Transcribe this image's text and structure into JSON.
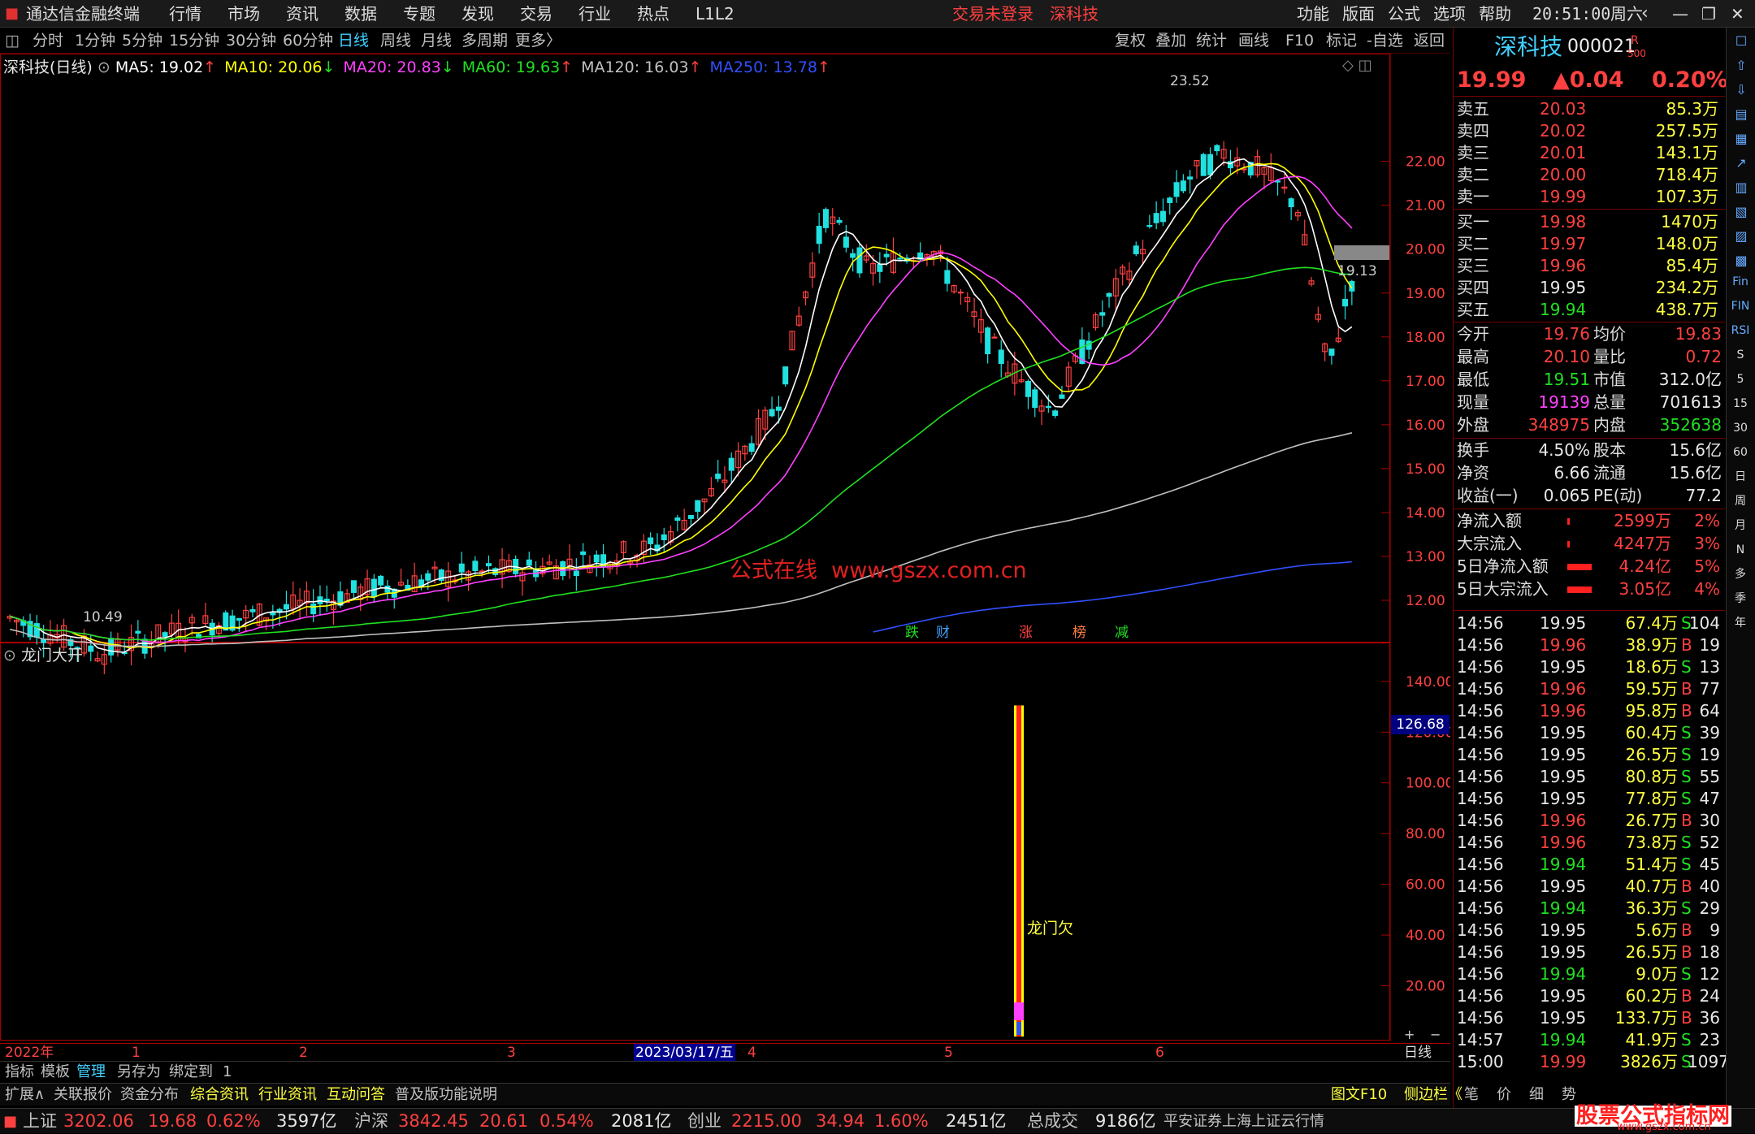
{
  "titlebar": {
    "app_title": "通达信金融终端",
    "menu": [
      "行情",
      "市场",
      "资讯",
      "数据",
      "专题",
      "发现",
      "交易",
      "行业",
      "热点",
      "L1L2"
    ],
    "login_status": "交易未登录",
    "stock_name": "深科技",
    "right_menu": [
      "功能",
      "版面",
      "公式",
      "选项",
      "帮助"
    ],
    "clock": "20:51:00",
    "weekday": "周六"
  },
  "periodbar": {
    "periods": [
      "分时",
      "1分钟",
      "5分钟",
      "15分钟",
      "30分钟",
      "60分钟",
      "日线",
      "周线",
      "月线",
      "多周期",
      "更多〉"
    ],
    "active": "日线",
    "tools": [
      "复权",
      "叠加",
      "统计",
      "画线",
      "F10",
      "标记",
      "-自选",
      "返回"
    ]
  },
  "kline": {
    "title": "深科技(日线)",
    "ma": [
      {
        "label": "MA5: 19.02",
        "arrow": "↑",
        "color": "#ffffff"
      },
      {
        "label": "MA10: 20.06",
        "arrow": "↓",
        "color": "#ffff00"
      },
      {
        "label": "MA20: 20.83",
        "arrow": "↓",
        "color": "#ff40ff"
      },
      {
        "label": "MA60: 19.63",
        "arrow": "↑",
        "color": "#20e020"
      },
      {
        "label": "MA120: 16.03",
        "arrow": "↑",
        "color": "#c0c0c0"
      },
      {
        "label": "MA250: 13.78",
        "arrow": "↑",
        "color": "#3050ff"
      }
    ],
    "high_label": "23.52",
    "low_label": "10.49",
    "cursor_label": "19.13",
    "price_axis": [
      "22.00",
      "21.00",
      "20.00",
      "19.00",
      "18.00",
      "17.00",
      "16.00",
      "15.00",
      "14.00",
      "13.00",
      "12.00"
    ],
    "watermark": "公式在线  www.gszx.com.cn",
    "event_tags": [
      {
        "t": "跌",
        "c": "#20e020"
      },
      {
        "t": "财",
        "c": "#40a0ff"
      },
      {
        "t": "涨",
        "c": "#ff4040"
      },
      {
        "t": "榜",
        "c": "#ff8040"
      },
      {
        "t": "减",
        "c": "#20e020"
      }
    ]
  },
  "indicator": {
    "title": "龙门大开",
    "axis": [
      "140.00",
      "120.00",
      "100.00",
      "80.00",
      "60.00",
      "40.00",
      "20.00"
    ],
    "current_value": "126.68",
    "bar_label": "龙门欠",
    "bar_value": 126.68
  },
  "timeaxis": {
    "labels": [
      "2022年",
      "1",
      "2",
      "3",
      "2023/03/17/五",
      "4",
      "5",
      "6"
    ],
    "period": "日线"
  },
  "bottomtabs": {
    "row1": [
      "指标",
      "模板",
      "管理",
      "另存为",
      "绑定到",
      "1"
    ],
    "row2": [
      "扩展∧",
      "关联报价",
      "资金分布",
      "综合资讯",
      "行业资讯",
      "互动问答",
      "普及版功能说明"
    ],
    "row2_right": [
      "图文F10",
      "侧边栏《",
      "笔",
      "价",
      "细",
      "势"
    ]
  },
  "quote": {
    "name": "深科技",
    "code": "000021",
    "flag_r": "R",
    "flag_500": "500",
    "price": "19.99",
    "change": "▲0.04",
    "pct": "0.20%",
    "sells": [
      {
        "l": "卖五",
        "p": "20.03",
        "v": "85.3万"
      },
      {
        "l": "卖四",
        "p": "20.02",
        "v": "257.5万"
      },
      {
        "l": "卖三",
        "p": "20.01",
        "v": "143.1万"
      },
      {
        "l": "卖二",
        "p": "20.00",
        "v": "718.4万"
      },
      {
        "l": "卖一",
        "p": "19.99",
        "v": "107.3万"
      }
    ],
    "buys": [
      {
        "l": "买一",
        "p": "19.98",
        "v": "1470万"
      },
      {
        "l": "买二",
        "p": "19.97",
        "v": "148.0万"
      },
      {
        "l": "买三",
        "p": "19.96",
        "v": "85.4万"
      },
      {
        "l": "买四",
        "p": "19.95",
        "v": "234.2万"
      },
      {
        "l": "买五",
        "p": "19.94",
        "v": "438.7万"
      }
    ],
    "stats": [
      {
        "a": "今开",
        "b": "19.76",
        "c": "均价",
        "d": "19.83"
      },
      {
        "a": "最高",
        "b": "20.10",
        "c": "量比",
        "d": "0.72"
      },
      {
        "a": "最低",
        "b": "19.51",
        "c": "市值",
        "d": "312.0亿"
      },
      {
        "a": "现量",
        "b": "19139",
        "c": "总量",
        "d": "701613"
      },
      {
        "a": "外盘",
        "b": "348975",
        "c": "内盘",
        "d": "352638"
      }
    ],
    "stats2": [
      {
        "a": "换手",
        "b": "4.50%",
        "c": "股本",
        "d": "15.6亿"
      },
      {
        "a": "净资",
        "b": "6.66",
        "c": "流通",
        "d": "15.6亿"
      },
      {
        "a": "收益(一)",
        "b": "0.065",
        "c": "PE(动)",
        "d": "77.2"
      }
    ],
    "flows": [
      {
        "a": "净流入额",
        "b": "2599万",
        "c": "2%"
      },
      {
        "a": "大宗流入",
        "b": "4247万",
        "c": "3%"
      },
      {
        "a": "5日净流入额",
        "b": "4.24亿",
        "c": "5%"
      },
      {
        "a": "5日大宗流入",
        "b": "3.05亿",
        "c": "4%"
      }
    ],
    "ticks": [
      [
        "14:56",
        "19.95",
        "67.4万",
        "S",
        "104"
      ],
      [
        "14:56",
        "19.96",
        "38.9万",
        "B",
        "19"
      ],
      [
        "14:56",
        "19.95",
        "18.6万",
        "S",
        "13"
      ],
      [
        "14:56",
        "19.96",
        "59.5万",
        "B",
        "77"
      ],
      [
        "14:56",
        "19.96",
        "95.8万",
        "B",
        "64"
      ],
      [
        "14:56",
        "19.95",
        "60.4万",
        "S",
        "39"
      ],
      [
        "14:56",
        "19.95",
        "26.5万",
        "S",
        "19"
      ],
      [
        "14:56",
        "19.95",
        "80.8万",
        "S",
        "55"
      ],
      [
        "14:56",
        "19.95",
        "77.8万",
        "S",
        "47"
      ],
      [
        "14:56",
        "19.96",
        "26.7万",
        "B",
        "30"
      ],
      [
        "14:56",
        "19.96",
        "73.8万",
        "S",
        "52"
      ],
      [
        "14:56",
        "19.94",
        "51.4万",
        "S",
        "45"
      ],
      [
        "14:56",
        "19.95",
        "40.7万",
        "B",
        "40"
      ],
      [
        "14:56",
        "19.94",
        "36.3万",
        "S",
        "29"
      ],
      [
        "14:56",
        "19.95",
        "5.6万",
        "B",
        "9"
      ],
      [
        "14:56",
        "19.95",
        "26.5万",
        "B",
        "18"
      ],
      [
        "14:56",
        "19.94",
        "9.0万",
        "S",
        "12"
      ],
      [
        "14:56",
        "19.95",
        "60.2万",
        "B",
        "24"
      ],
      [
        "14:56",
        "19.95",
        "133.7万",
        "B",
        "36"
      ],
      [
        "14:57",
        "19.94",
        "41.9万",
        "S",
        "23"
      ],
      [
        "15:00",
        "19.99",
        "3826万",
        "S",
        "1097"
      ]
    ]
  },
  "statusbar": {
    "items": [
      {
        "n": "上证",
        "v": "3202.06",
        "c": "19.68",
        "p": "0.62%",
        "a": "3597亿"
      },
      {
        "n": "沪深",
        "v": "3842.45",
        "c": "20.61",
        "p": "0.54%",
        "a": "2081亿"
      },
      {
        "n": "创业",
        "v": "2215.00",
        "c": "34.94",
        "p": "1.60%",
        "a": "2451亿"
      }
    ],
    "total_label": "总成交",
    "total": "9186亿",
    "broker": "平安证券上海上证云行情",
    "brand": "股票公式指标网",
    "brand_url": "www.gszx.com.cn"
  },
  "rtools": [
    "Fin",
    "FIN",
    "RSI",
    "S",
    "5",
    "15",
    "30",
    "60",
    "日",
    "周",
    "月",
    "N",
    "多",
    "季",
    "年"
  ],
  "colors": {
    "up": "#ff4040",
    "down": "#20e020",
    "neutral": "#e8e8e8",
    "frame": "#aa0000"
  }
}
